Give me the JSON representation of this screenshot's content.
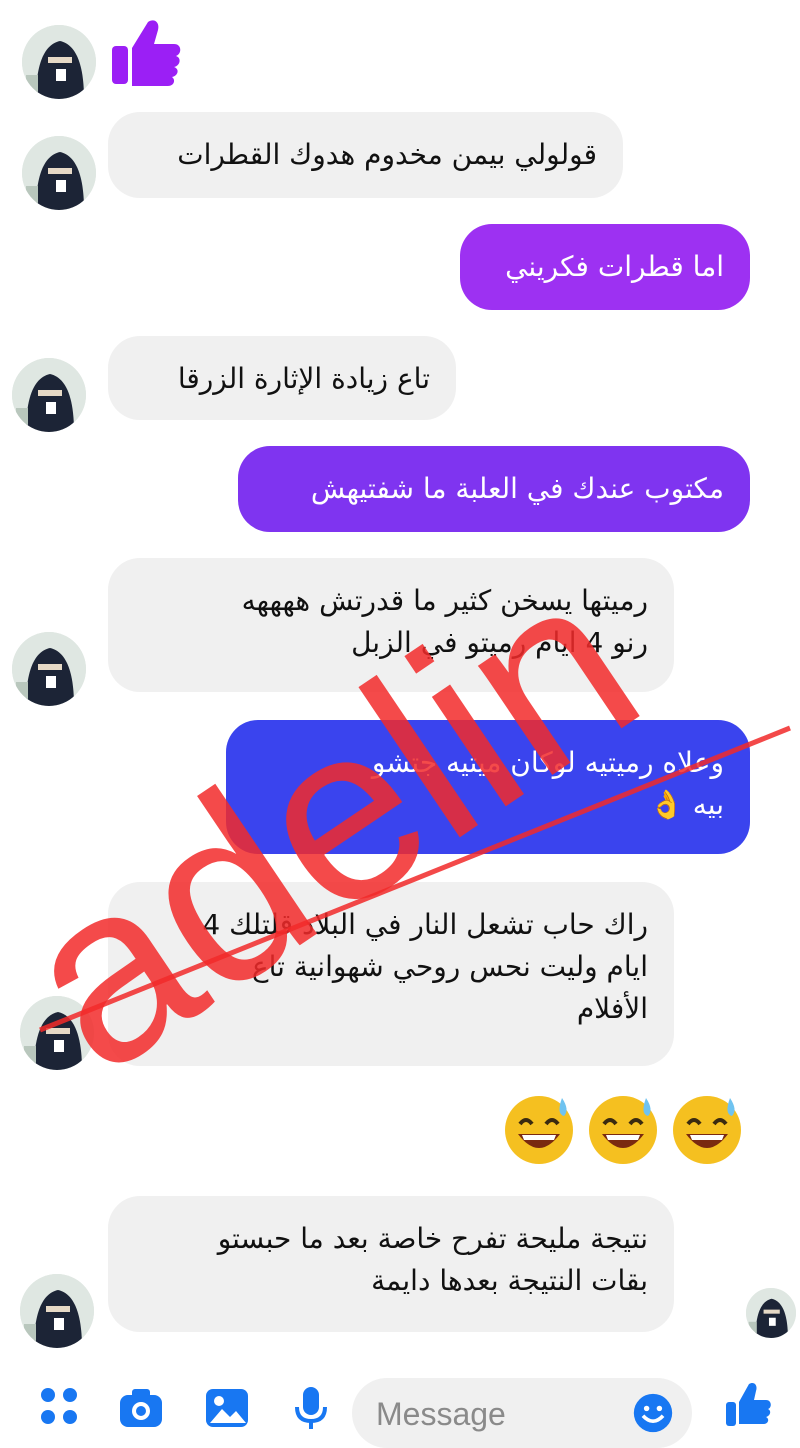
{
  "conversation": {
    "messages": [
      {
        "direction": "incoming",
        "lines": [
          "قولولي بيمن مخدوم هدوك القطرات"
        ]
      },
      {
        "direction": "outgoing",
        "lines": [
          "اما قطرات فكريني"
        ]
      },
      {
        "direction": "incoming",
        "lines": [
          "تاع زيادة الإثارة  الزرقا"
        ]
      },
      {
        "direction": "outgoing",
        "lines": [
          "مكتوب عندك في العلبة ما شفتيهش"
        ]
      },
      {
        "direction": "incoming",
        "lines": [
          "رميتها يسخن كثير ما قدرتش ههههه",
          "رنو 4 ايام رميتو في الزبل"
        ]
      },
      {
        "direction": "outgoing",
        "lines": [
          "وعلاه رميتيه لوكان ميتيه جتشو",
          "بيه 👌"
        ]
      },
      {
        "direction": "incoming",
        "lines": [
          "راك حاب تشعل النار في البلاد قلتلك 4",
          "ايام وليت نحس روحي شهوانية تاع",
          "الأفلام"
        ]
      },
      {
        "direction": "outgoing",
        "emoji": "😅😅😅"
      },
      {
        "direction": "incoming",
        "lines": [
          "نتيجة مليحة تفرح خاصة بعد ما حبستو",
          "بقات النتيجة بعدها دايمة"
        ]
      }
    ]
  },
  "composer": {
    "placeholder": "Message",
    "icons": [
      "apps-icon",
      "camera-icon",
      "image-icon",
      "microphone-icon",
      "emoji-icon",
      "thumbs-up-icon"
    ]
  },
  "watermark": {
    "text": "adelin"
  },
  "colors": {
    "accent": "#1877f2",
    "outgoing_top": "#a030f0",
    "outgoing_bottom": "#3440ee",
    "incoming_bg": "#f0f0f0",
    "watermark": "#f22a2a"
  }
}
